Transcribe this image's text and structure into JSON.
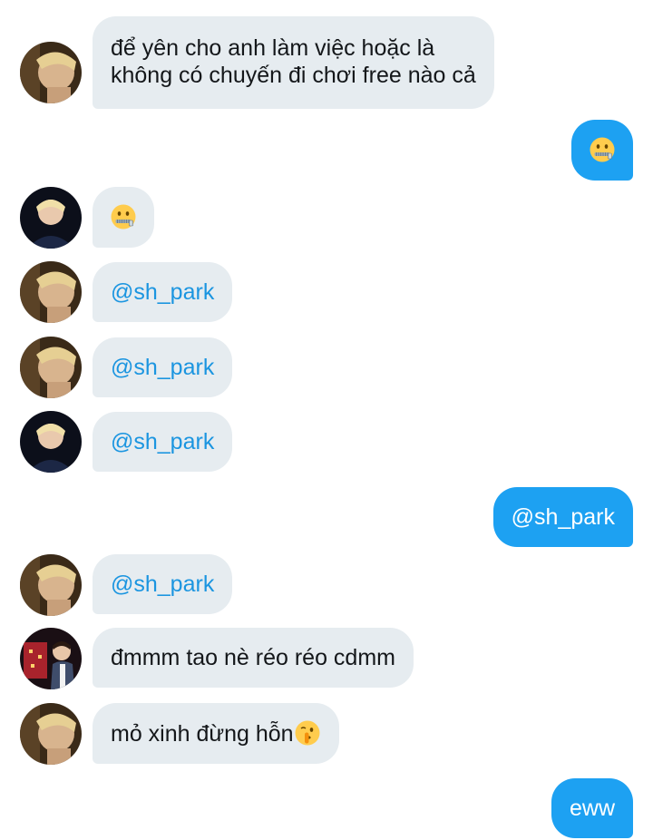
{
  "messages": [
    {
      "side": "in",
      "avatar": "avatar-a",
      "lines": [
        "để yên cho anh làm việc hoặc là",
        "không có chuyến đi chơi free nào cả"
      ]
    },
    {
      "side": "out",
      "emoji": "zipper-mouth-face"
    },
    {
      "side": "in",
      "avatar": "avatar-b",
      "emoji": "zipper-mouth-face"
    },
    {
      "side": "in",
      "avatar": "avatar-a",
      "text": "@sh_park"
    },
    {
      "side": "in",
      "avatar": "avatar-a",
      "text": "@sh_park"
    },
    {
      "side": "in",
      "avatar": "avatar-b",
      "text": "@sh_park"
    },
    {
      "side": "out",
      "text": "@sh_park"
    },
    {
      "side": "in",
      "avatar": "avatar-a",
      "text": "@sh_park"
    },
    {
      "side": "in",
      "avatar": "avatar-c",
      "text": "đmmm tao nè réo réo cdmm"
    },
    {
      "side": "in",
      "avatar": "avatar-a",
      "text": "mỏ xinh đừng hỗn",
      "emoji": "shushing-face"
    },
    {
      "side": "out",
      "text": "eww"
    }
  ],
  "colors": {
    "incoming_bubble": "#e6ecf0",
    "outgoing_bubble": "#1da1f2",
    "mention": "#1b95e0"
  }
}
